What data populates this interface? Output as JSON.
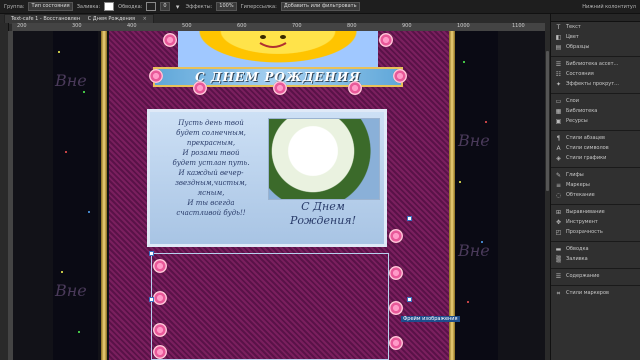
{
  "toolbar": {
    "group_label": "Группа:",
    "group_value": "Тип состояния",
    "fill_label": "Заливка:",
    "stroke_label": "Обводка:",
    "stroke_width": "0",
    "effects_label": "Эффекты:",
    "opacity_value": "100%",
    "hyperlink_label": "Гиперссылка:",
    "hyperlink_value": "Добавить или фильтровать",
    "right_label": "Нижний колонтитул"
  },
  "doc_tab": {
    "title": "Text-cafe 1 - Восстановлен",
    "subtitle": "С Днем Рождения",
    "close": "×"
  },
  "ruler": {
    "ticks": [
      "200",
      "300",
      "400",
      "500",
      "600",
      "700",
      "800",
      "900",
      "1000",
      "1100"
    ]
  },
  "canvas": {
    "banner_text": "С ДНЕМ  РОЖДЕНИЯ",
    "watermark": "Вне",
    "poem_lines": [
      "Пусть день твой",
      "будет солнечным,",
      "прекрасным,",
      "И розами твой",
      "будет устлан путь.",
      "И каждый вечер-",
      "звездным,чистым,",
      "ясным,",
      "И ты всегда",
      "счастливой будь!!"
    ],
    "greeting_line1": "С Днем",
    "greeting_line2": "Рождения!",
    "selection_label": "Фрейм изображения"
  },
  "right_dock": {
    "items": [
      {
        "icon": "T",
        "label": "Текст"
      },
      {
        "icon": "◧",
        "label": "Цвет"
      },
      {
        "icon": "▤",
        "label": "Образцы"
      },
      {
        "icon": "☰",
        "label": "Библиотека ассет..."
      },
      {
        "icon": "☷",
        "label": "Состояния"
      },
      {
        "icon": "✦",
        "label": "Эффекты прокрут..."
      },
      {
        "icon": "▭",
        "label": "Слои"
      },
      {
        "icon": "▦",
        "label": "Библиотека"
      },
      {
        "icon": "▣",
        "label": "Ресурсы"
      },
      {
        "icon": "¶",
        "label": "Стили абзацев"
      },
      {
        "icon": "A",
        "label": "Стили символов"
      },
      {
        "icon": "◈",
        "label": "Стили графики"
      },
      {
        "icon": "✎",
        "label": "Глифы"
      },
      {
        "icon": "≡",
        "label": "Маркеры"
      },
      {
        "icon": "◌",
        "label": "Обтекание"
      },
      {
        "icon": "⊞",
        "label": "Выравнивание"
      },
      {
        "icon": "✥",
        "label": "Инструмент"
      },
      {
        "icon": "◰",
        "label": "Прозрачность"
      },
      {
        "icon": "▬",
        "label": "Обводка"
      },
      {
        "icon": "▒",
        "label": "Заливка"
      },
      {
        "icon": "☰",
        "label": "Содержание"
      },
      {
        "icon": "⌗",
        "label": "Стили маркеров"
      }
    ]
  }
}
